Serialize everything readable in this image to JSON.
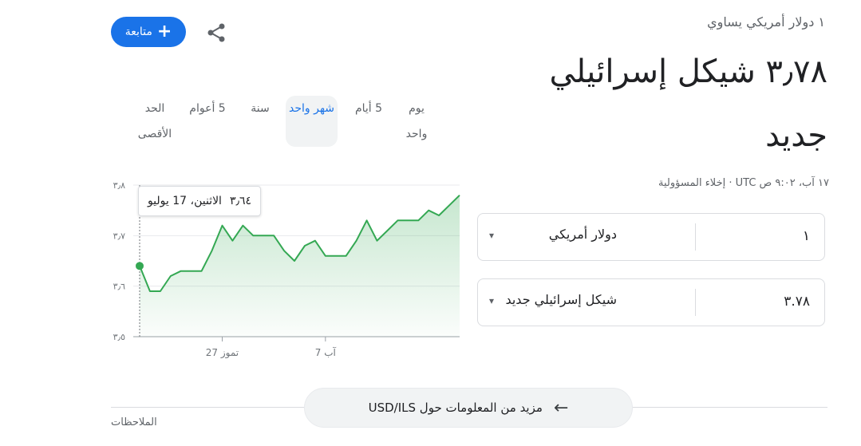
{
  "header": {
    "from_text": "١ دولار أمريكي يساوي",
    "to_value_line1": "٣٫٧٨ شيكل إسرائيلي",
    "to_value_line2": "جديد",
    "meta": "١٧ آب، ٩:٠٢ ص UTC · إخلاء المسؤولية"
  },
  "actions": {
    "follow_label": "متابعة",
    "follow_icon": "plus-icon",
    "share_icon": "share-icon"
  },
  "tabs": [
    {
      "label": "يوم واحد",
      "active": false
    },
    {
      "label": "5 أيام",
      "active": false
    },
    {
      "label": "شهر واحد",
      "active": true
    },
    {
      "label": "سنة",
      "active": false
    },
    {
      "label": "5 أعوام",
      "active": false
    },
    {
      "label": "الحد الأقصى",
      "active": false
    }
  ],
  "converter": {
    "from": {
      "amount": "١",
      "currency": "دولار أمريكي"
    },
    "to": {
      "amount": "٣.٧٨",
      "currency": "شيكل إسرائيلي جديد"
    }
  },
  "tooltip": {
    "value": "٣٫٦٤",
    "date": "الاثنين، 17 يوليو"
  },
  "chart_data": {
    "type": "area",
    "title": "",
    "xlabel": "",
    "ylabel": "",
    "y_ticks": [
      {
        "value": 3.8,
        "label": "٣٫٨"
      },
      {
        "value": 3.7,
        "label": "٣٫٧"
      },
      {
        "value": 3.6,
        "label": "٣٫٦"
      },
      {
        "value": 3.5,
        "label": "٣٫٥"
      }
    ],
    "x_ticks": [
      {
        "index": 8,
        "label": "27 تموز"
      },
      {
        "index": 18,
        "label": "7 آب"
      }
    ],
    "ylim": [
      3.5,
      3.8
    ],
    "grid": true,
    "color": "#34a853",
    "fill_color": "#e6f4ea",
    "series": [
      {
        "values": [
          3.64,
          3.59,
          3.59,
          3.62,
          3.63,
          3.63,
          3.63,
          3.67,
          3.72,
          3.69,
          3.72,
          3.7,
          3.7,
          3.7,
          3.67,
          3.65,
          3.68,
          3.69,
          3.66,
          3.66,
          3.66,
          3.69,
          3.73,
          3.69,
          3.71,
          3.73,
          3.73,
          3.73,
          3.75,
          3.74,
          3.76,
          3.78
        ]
      }
    ],
    "highlight_index": 0
  },
  "footer": {
    "more_label": "مزيد من المعلومات حول USD/ILS",
    "arrow_icon": "arrow-left-icon",
    "notes_label": "الملاحظات"
  }
}
